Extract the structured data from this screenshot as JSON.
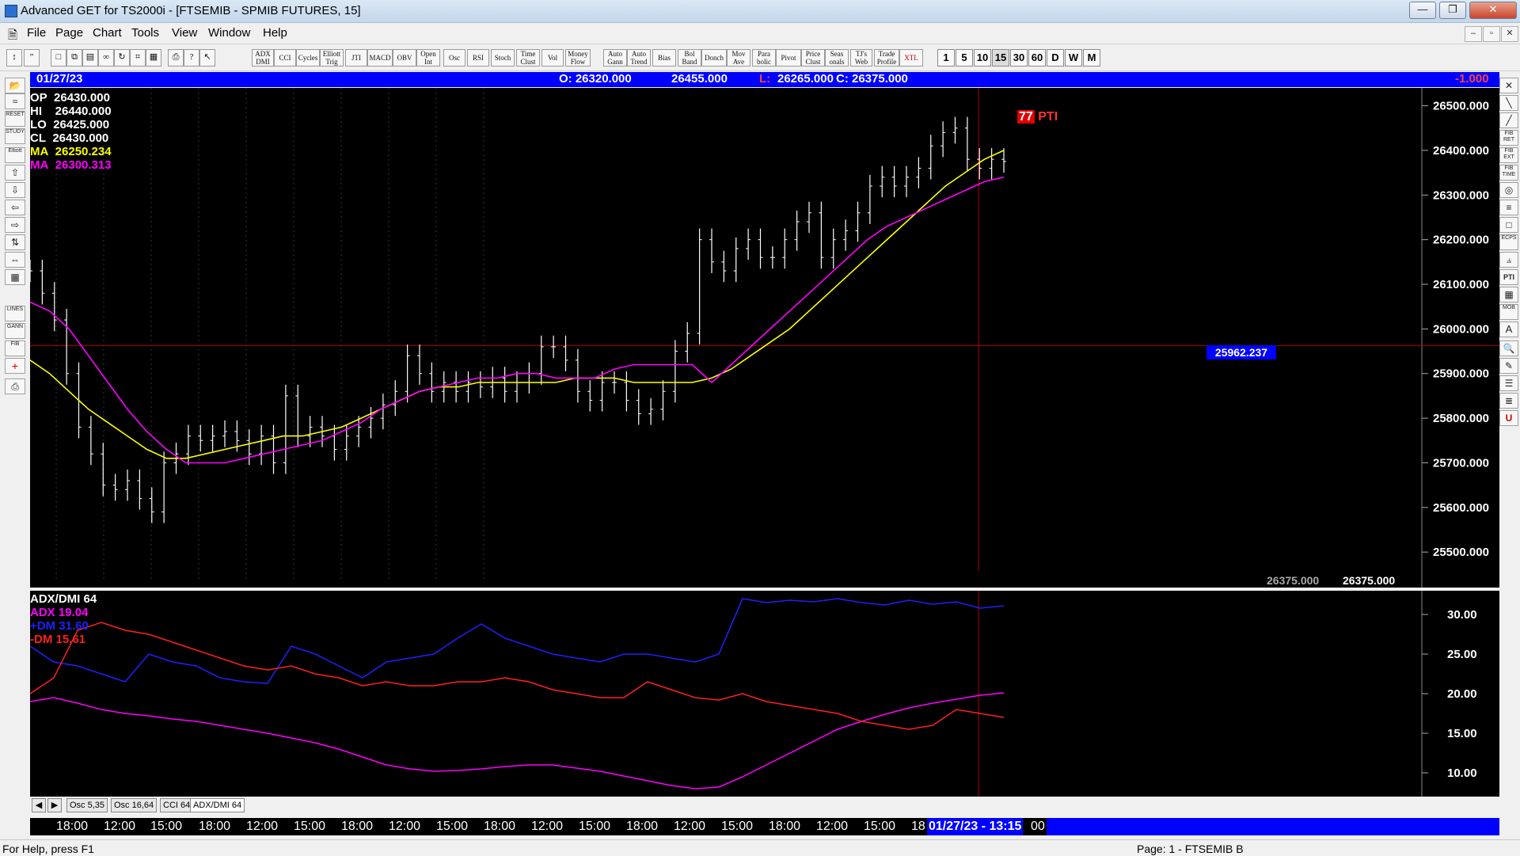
{
  "window": {
    "title": "Advanced GET for TS2000i - [FTSEMIB - SPMIB FUTURES, 15]",
    "buttons": [
      "—",
      "❐",
      "✕"
    ],
    "mdi_buttons": [
      "–",
      "▫",
      "✕"
    ]
  },
  "menu": [
    "File",
    "Page",
    "Chart",
    "Tools",
    "View",
    "Window",
    "Help"
  ],
  "toolbar": {
    "studies": [
      "ADX DMI",
      "CCI",
      "Cycles",
      "Elliott Trig",
      "JTI",
      "MACD",
      "OBV",
      "Open Int",
      "Osc",
      "RSI",
      "Stoch",
      "Time Clust",
      "Vol",
      "Money Flow",
      "Auto Gann",
      "Auto Trend",
      "Bias",
      "Bol Band",
      "Donch",
      "Mov Ave",
      "Para bolic",
      "Pivot",
      "Price Clust",
      "Seas onals",
      "TJ's Web",
      "Trade Profile",
      "XTL"
    ],
    "timeframes": [
      "1",
      "5",
      "10",
      "15",
      "30",
      "60",
      "D",
      "W",
      "M"
    ],
    "selected_timeframe": "15"
  },
  "left_tools": [
    "RESET",
    "STUDY",
    "Elliott",
    "LINES",
    "GANN",
    "FIB"
  ],
  "right_tools": [
    "FIB RET",
    "FIB EXT",
    "FIB TIME",
    "ECPS",
    "PTI",
    "MOB"
  ],
  "datebar": {
    "date": "01/27/23",
    "open": "O: 26320.000",
    "high": "26455.000",
    "low_label": "L:",
    "low": "26265.000",
    "close": "C: 26375.000",
    "change": "-1.000"
  },
  "price_panel": {
    "rows": [
      {
        "label": "OP",
        "value": "26430.000",
        "color": "#ffffff"
      },
      {
        "label": "HI",
        "value": "26440.000",
        "color": "#ffffff"
      },
      {
        "label": "LO",
        "value": "26425.000",
        "color": "#ffffff"
      },
      {
        "label": "CL",
        "value": "26430.000",
        "color": "#ffffff"
      },
      {
        "label": "MA",
        "value": "26250.234",
        "color": "#ffff00"
      },
      {
        "label": "MA",
        "value": "26300.313",
        "color": "#ff00ff"
      }
    ],
    "cursor_price": "25962.237",
    "last_left": "26375.000",
    "last_right": "26375.000",
    "pti_value": "77",
    "pti_label": "PTI"
  },
  "indicator_panel": {
    "title": "ADX/DMI 64",
    "adx": "ADX 19.04",
    "pdm": "+DM 31.60",
    "mdm": "-DM  15.61"
  },
  "tabs": [
    "Osc 5,35",
    "Osc 16,64",
    "CCI 64",
    "ADX/DMI 64"
  ],
  "active_tab": "ADX/DMI 64",
  "time_axis": {
    "labels": [
      "18:00",
      "12:00",
      "15:00",
      "18:00",
      "12:00",
      "15:00",
      "18:00",
      "12:00",
      "15:00",
      "18:00",
      "12:00",
      "15:00",
      "18:00",
      "12:00",
      "15:00",
      "18:00",
      "12:00",
      "15:00",
      "18"
    ],
    "cursor": "01/27/23 - 13:15",
    "tail": "00"
  },
  "status": {
    "help": "For Help, press F1",
    "page": "Page: 1 - FTSEMIB B"
  },
  "chart_data": [
    {
      "type": "candlestick",
      "title": "FTSEMIB - SPMIB FUTURES, 15",
      "ylim": [
        25440,
        26540
      ],
      "yticks": [
        "25500.000",
        "25600.000",
        "25700.000",
        "25800.000",
        "25900.000",
        "26000.000",
        "26100.000",
        "26200.000",
        "26300.000",
        "26400.000",
        "26500.000"
      ],
      "x": [
        0,
        5,
        10,
        15,
        20,
        25,
        30,
        35,
        40,
        45,
        50,
        55,
        60,
        65,
        70,
        75,
        80,
        85,
        90,
        95,
        100,
        105,
        110,
        115,
        120,
        125,
        130,
        135,
        140,
        145,
        150,
        155,
        160,
        165,
        170,
        175,
        180,
        185,
        190,
        195,
        200,
        205,
        210,
        215,
        220,
        225,
        230,
        235,
        240,
        245,
        250,
        255,
        260,
        265,
        270,
        275,
        280,
        285,
        290,
        295,
        300,
        305,
        310,
        315,
        320,
        325,
        330,
        335,
        340,
        345,
        350,
        355,
        360,
        365,
        370,
        375,
        380,
        385,
        390,
        395,
        400
      ],
      "series": [
        {
          "values": [
            26130,
            26080,
            26020,
            25900,
            25780,
            25720,
            25650,
            25640,
            25660,
            25620,
            25590,
            25700,
            25720,
            25760,
            25750,
            25760,
            25770,
            25750,
            25720,
            25760,
            25700,
            25850,
            25760,
            25780,
            25760,
            25730,
            25760,
            25780,
            25800,
            25830,
            25860,
            25940,
            25900,
            25860,
            25880,
            25860,
            25880,
            25870,
            25890,
            25860,
            25880,
            25900,
            25960,
            25960,
            25930,
            25860,
            25840,
            25880,
            25880,
            25840,
            25810,
            25820,
            25860,
            25950,
            25990,
            26200,
            26150,
            26130,
            26180,
            26200,
            26160,
            26160,
            26200,
            26240,
            26260,
            26160,
            26200,
            26220,
            26260,
            26320,
            26340,
            26320,
            26340,
            26360,
            26410,
            26440,
            26450,
            26380,
            26360,
            26380,
            26375
          ]
        },
        {
          "name": "MA",
          "values": [
            25930,
            25900,
            25860,
            25820,
            25790,
            25760,
            25730,
            25710,
            25710,
            25720,
            25730,
            25740,
            25750,
            25760,
            25760,
            25770,
            25780,
            25800,
            25820,
            25840,
            25860,
            25870,
            25870,
            25880,
            25880,
            25880,
            25880,
            25880,
            25890,
            25890,
            25890,
            25880,
            25880,
            25880,
            25880,
            25890,
            25910,
            25940,
            25970,
            26000,
            26040,
            26080,
            26120,
            26160,
            26200,
            26240,
            26280,
            26320,
            26350,
            26380,
            26400
          ]
        },
        {
          "name": "MA",
          "values": [
            26060,
            26040,
            26000,
            25940,
            25880,
            25820,
            25770,
            25730,
            25700,
            25700,
            25700,
            25710,
            25720,
            25730,
            25740,
            25750,
            25770,
            25790,
            25820,
            25840,
            25860,
            25870,
            25880,
            25890,
            25890,
            25900,
            25900,
            25890,
            25890,
            25890,
            25910,
            25920,
            25920,
            25920,
            25920,
            25880,
            25920,
            25960,
            26000,
            26040,
            26080,
            26120,
            26160,
            26200,
            26230,
            26250,
            26270,
            26290,
            26310,
            26330,
            26340
          ]
        }
      ]
    },
    {
      "type": "line",
      "title": "ADX/DMI 64",
      "ylim": [
        7,
        33
      ],
      "yticks": [
        "10.00",
        "15.00",
        "20.00",
        "25.00",
        "30.00"
      ],
      "series": [
        {
          "name": "ADX",
          "values": [
            19,
            19.5,
            18.8,
            18,
            17.5,
            17.2,
            16.8,
            16.5,
            16,
            15.5,
            15,
            14.4,
            13.8,
            13,
            12,
            11,
            10.5,
            10.2,
            10.3,
            10.5,
            10.8,
            11,
            11,
            10.6,
            10.2,
            9.6,
            9,
            8.4,
            8,
            8.2,
            9.5,
            11,
            12.5,
            14,
            15.5,
            16.5,
            17.4,
            18.2,
            18.8,
            19.3,
            19.8,
            20.1
          ]
        },
        {
          "name": "+DM",
          "values": [
            26,
            24,
            23.5,
            22.5,
            21.5,
            25,
            24,
            23.5,
            22,
            21.5,
            21.3,
            26,
            25,
            23.5,
            22,
            24,
            24.5,
            25,
            27,
            28.8,
            27,
            26,
            25,
            24.5,
            24,
            25,
            25,
            24.5,
            24,
            25,
            32,
            31.5,
            31.8,
            31.6,
            32,
            31.5,
            31.2,
            31.8,
            31.3,
            31.6,
            30.8,
            31.1
          ]
        },
        {
          "name": "-DM",
          "values": [
            20,
            22,
            28,
            29,
            28,
            27.5,
            26.5,
            25.5,
            24.5,
            23.5,
            23,
            23.5,
            22.5,
            22,
            21,
            21.5,
            21,
            21,
            21.5,
            21.5,
            22,
            21.5,
            20.5,
            20,
            19.5,
            19.5,
            21.5,
            20.5,
            19.5,
            19.2,
            20,
            19,
            18.5,
            18,
            17.5,
            16.5,
            16,
            15.5,
            16,
            18,
            17.5,
            17
          ]
        }
      ]
    }
  ]
}
